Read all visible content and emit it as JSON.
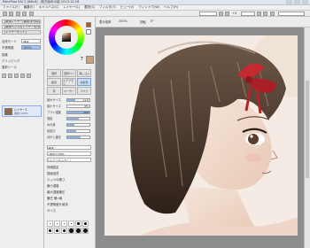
{
  "window": {
    "title": "PaintTool SAI 2 [64bit] - 描き始めの絵 2013.12.16"
  },
  "menu": [
    "ファイル(F)",
    "編集(E)",
    "キャンバス(C)",
    "レイヤー(L)",
    "選択(S)",
    "フィルタ(T)",
    "ビュー(V)",
    "ウィンドウ(W)",
    "ヘルプ(H)"
  ],
  "toolbar": {
    "angle": "+0",
    "zoom_value": "",
    "rotation_value": ""
  },
  "layer_panel": {
    "rows": [
      "[新規レイヤー(通常)を作成]",
      "[新規ペン入れレイヤーを作成]",
      "[レイヤーセット]"
    ],
    "mode_label": "合成モード",
    "mode_value": "通常",
    "opacity_label": "不透明度",
    "opacity_value": "100%",
    "protect_label": "保護",
    "clip_label": "クリッピング",
    "selection_source": "選択ソース",
    "layer_name": "レイヤー1",
    "layer_mode": "通常 100%"
  },
  "color_panel": {
    "main_color": "#b35a1f",
    "sub_color": "#ffffff",
    "accent_swatch": "#c8a27c"
  },
  "tools": [
    "選択",
    "選択ペン",
    "消しゴム",
    "鉛筆",
    "エアブラシ",
    "水彩筆",
    "筆",
    "マーカー",
    "バケツ"
  ],
  "brush_settings": [
    {
      "label": "最大サイズ",
      "value": "x1.0",
      "fill": 0.35
    },
    {
      "label": "最小サイズ",
      "value": "0%",
      "fill": 0.0
    },
    {
      "label": "ブラシ濃度",
      "value": "100",
      "fill": 1.0
    },
    {
      "label": "混色",
      "value": "",
      "fill": 0.5
    },
    {
      "label": "水分量",
      "value": "",
      "fill": 0.3
    },
    {
      "label": "色延び",
      "value": "",
      "fill": 0.4
    },
    {
      "label": "ぼかし筆圧",
      "value": "",
      "fill": 0.6
    }
  ],
  "brush_options": {
    "blend_mode": "通常",
    "texture_label": "(通常の円形)",
    "paper_label": "(テクスチャなし)",
    "detail_label": "詳細設定",
    "keep_opacity": "不透明度を維持",
    "quality_label": "描画品質",
    "edge_label": "エッジの硬さ",
    "min_density": "最小濃度",
    "max_pressure": "最大濃度筆圧",
    "pressure_label": "筆圧 硬⇔軟",
    "pressure_size": "サイズ"
  },
  "brush_sizes": [
    "0.7",
    "0.8",
    "1",
    "1.5",
    "2",
    "2.3",
    "2.6",
    "3",
    "3.5",
    "4",
    "5",
    "6"
  ],
  "navigator": {
    "zoom_label": "表示倍率",
    "zoom_value": "200%",
    "angle_label": "回転",
    "angle_value": "0°"
  }
}
